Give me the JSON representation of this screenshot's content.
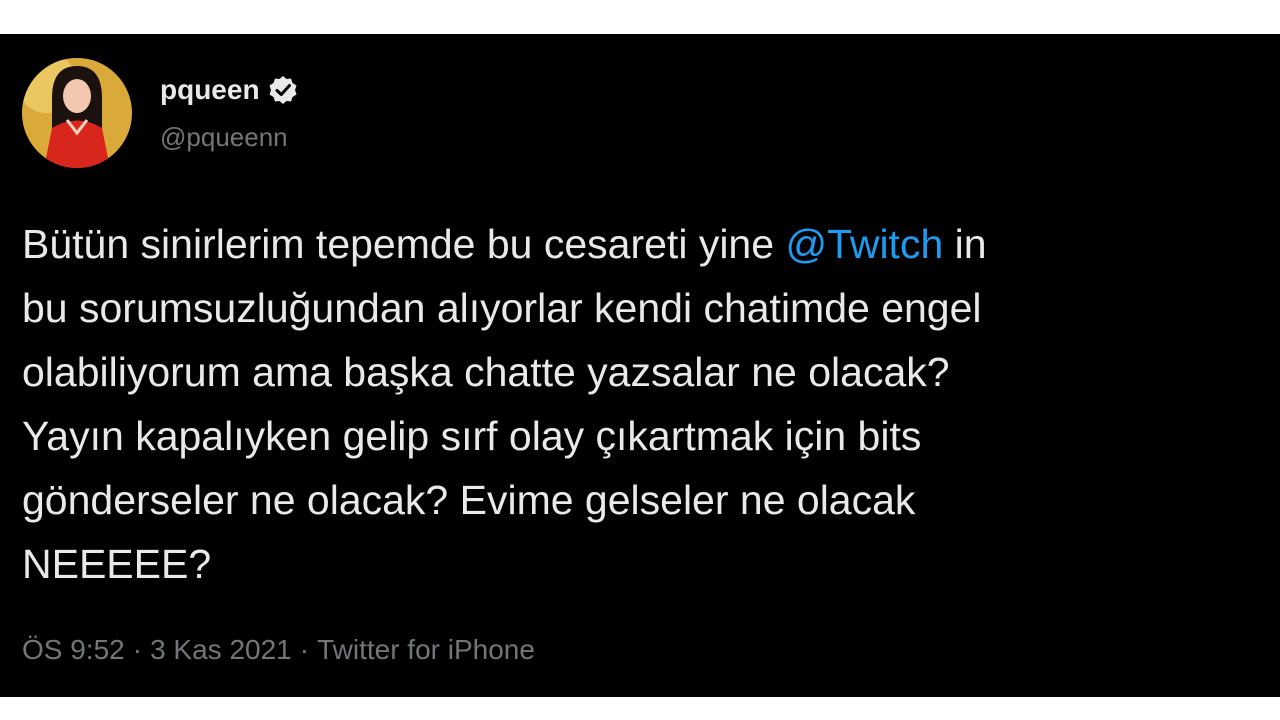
{
  "tweet": {
    "author": {
      "display_name": "pqueen",
      "handle": "@pqueenn",
      "verified_icon": "verified-badge-icon"
    },
    "text_lines": [
      {
        "before": "Bütün sinirlerim tepemde bu cesareti yine ",
        "mention": "@Twitch",
        "after": " in"
      },
      {
        "text": "bu sorumsuzluğundan alıyorlar kendi chatimde engel"
      },
      {
        "text": "olabiliyorum ama başka chatte yazsalar ne olacak?"
      },
      {
        "text": "Yayın kapalıyken gelip sırf olay çıkartmak için bits"
      },
      {
        "text": "gönderseler ne olacak? Evime gelseler ne olacak"
      },
      {
        "text": "NEEEEE?"
      }
    ],
    "meta": {
      "time": "ÖS 9:52",
      "separator": "·",
      "date": "3 Kas 2021",
      "source": "Twitter for iPhone"
    }
  },
  "colors": {
    "background": "#000000",
    "text": "#e7e9ea",
    "muted": "#71767b",
    "mention": "#1d9bf0"
  }
}
